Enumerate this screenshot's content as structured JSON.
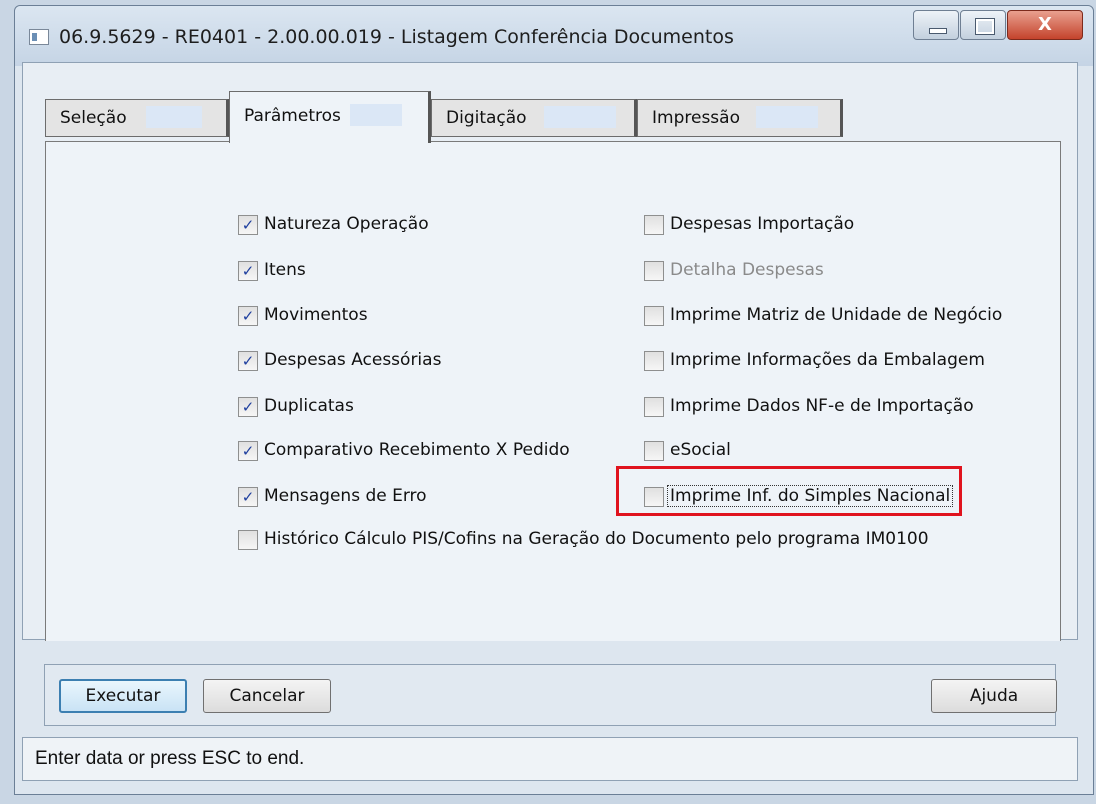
{
  "window": {
    "title": "06.9.5629 - RE0401 - 2.00.00.019 - Listagem Conferência Documentos",
    "close_glyph": "X"
  },
  "tabs": [
    {
      "label": "Seleção",
      "active": false
    },
    {
      "label": "Parâmetros",
      "active": true
    },
    {
      "label": "Digitação",
      "active": false
    },
    {
      "label": "Impressão",
      "active": false
    }
  ],
  "options_left": [
    {
      "label": "Natureza Operação",
      "checked": true
    },
    {
      "label": "Itens",
      "checked": true
    },
    {
      "label": "Movimentos",
      "checked": true
    },
    {
      "label": "Despesas Acessórias",
      "checked": true
    },
    {
      "label": "Duplicatas",
      "checked": true
    },
    {
      "label": "Comparativo Recebimento X Pedido",
      "checked": true
    },
    {
      "label": "Mensagens de Erro",
      "checked": true
    },
    {
      "label": "Histórico Cálculo PIS/Cofins na Geração do Documento pelo programa IM0100",
      "checked": false
    }
  ],
  "options_right": [
    {
      "label": "Despesas Importação",
      "checked": false
    },
    {
      "label": "Detalha Despesas",
      "checked": false,
      "disabled": true
    },
    {
      "label": "Imprime Matriz de Unidade de Negócio",
      "checked": false
    },
    {
      "label": "Imprime Informações da Embalagem",
      "checked": false
    },
    {
      "label": "Imprime Dados NF-e de Importação",
      "checked": false
    },
    {
      "label": "eSocial",
      "checked": false
    },
    {
      "label": "Imprime Inf. do Simples Nacional",
      "checked": false,
      "highlighted": true
    }
  ],
  "buttons": {
    "execute": "Executar",
    "cancel": "Cancelar",
    "help": "Ajuda"
  },
  "status": {
    "text": "Enter data or press ESC to end."
  },
  "colors": {
    "highlight": "#e0131e",
    "check": "#1f3f9e"
  },
  "icons": {
    "check": "✓"
  }
}
